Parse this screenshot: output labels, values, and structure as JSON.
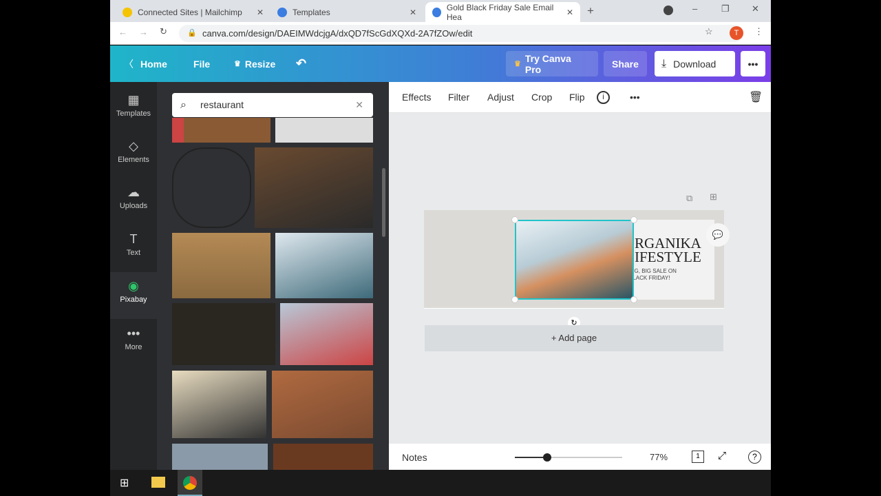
{
  "browser": {
    "tabs": [
      {
        "title": "Connected Sites | Mailchimp",
        "color": "#f5c400"
      },
      {
        "title": "Templates",
        "color": "#3b7de0"
      },
      {
        "title": "Gold Black Friday Sale Email Hea",
        "color": "#3b7de0"
      }
    ],
    "url": "canva.com/design/DAEIMWdcjgA/dxQD7fScGdXQXd-2A7fZOw/edit",
    "avatar": "T"
  },
  "topbar": {
    "home": "Home",
    "file": "File",
    "resize": "Resize",
    "try_pro": "Try Canva Pro",
    "share": "Share",
    "download": "Download"
  },
  "rail": [
    {
      "label": "Templates",
      "icon": "▦"
    },
    {
      "label": "Elements",
      "icon": "◇"
    },
    {
      "label": "Uploads",
      "icon": "☁"
    },
    {
      "label": "Text",
      "icon": "T"
    },
    {
      "label": "Pixabay",
      "icon": "◉"
    },
    {
      "label": "More",
      "icon": "•••"
    }
  ],
  "search": {
    "value": "restaurant"
  },
  "toolbar": {
    "effects": "Effects",
    "filter": "Filter",
    "adjust": "Adjust",
    "crop": "Crop",
    "flip": "Flip"
  },
  "design": {
    "line1": "RGANIKA",
    "line2": "IFESTYLE",
    "line3": "BIG, BIG SALE ON",
    "line4": "BLACK FRIDAY!"
  },
  "canvas": {
    "add_page": "+ Add page"
  },
  "footer": {
    "notes": "Notes",
    "zoom": "77%",
    "page": "1",
    "zoom_fraction": 0.3
  }
}
